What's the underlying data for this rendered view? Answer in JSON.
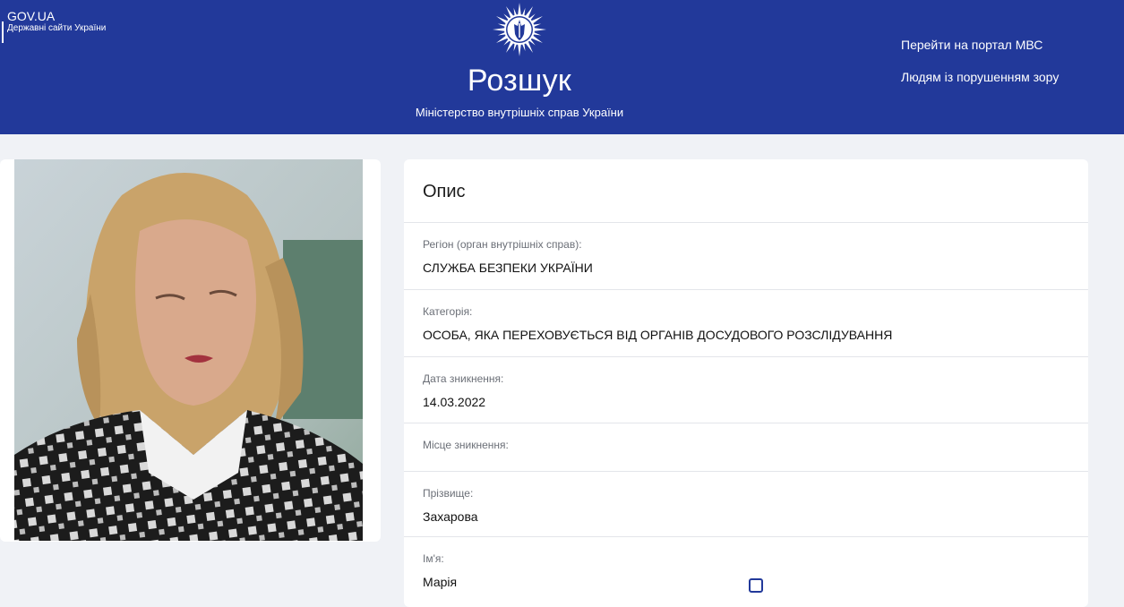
{
  "header": {
    "gov_title": "GOV.UA",
    "gov_subtitle": "Державні сайти України",
    "site_title": "Розшук",
    "site_subtitle": "Міністерство внутрішніх справ України",
    "nav": [
      {
        "label": "Перейти на портал МВС"
      },
      {
        "label": "Людям із порушенням зору"
      }
    ],
    "icon": "police-star-emblem-icon"
  },
  "photo": {
    "icon": "portrait-photo"
  },
  "description": {
    "title": "Опис",
    "fields": [
      {
        "label": "Регіон (орган внутрішніх справ):",
        "value": "СЛУЖБА БЕЗПЕКИ УКРАЇНИ"
      },
      {
        "label": "Категорія:",
        "value": "ОСОБА, ЯКА ПЕРЕХОВУЄТЬСЯ ВІД ОРГАНІВ ДОСУДОВОГО РОЗСЛІДУВАННЯ"
      },
      {
        "label": "Дата зникнення:",
        "value": "14.03.2022"
      },
      {
        "label": "Місце зникнення:",
        "value": ""
      },
      {
        "label": "Прізвище:",
        "value": "Захарова"
      },
      {
        "label": "Ім'я:",
        "value": "Марія"
      }
    ]
  },
  "colors": {
    "header_bg": "#22399a",
    "page_bg": "#f0f2f6",
    "card_bg": "#ffffff"
  }
}
